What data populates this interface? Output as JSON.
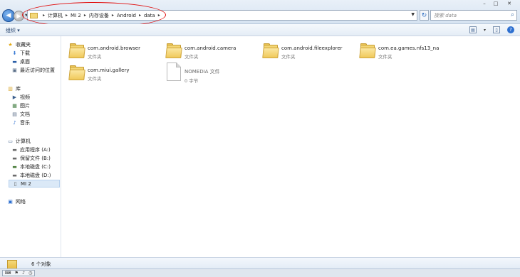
{
  "window_controls": {
    "minimize": "–",
    "maximize": "□",
    "close": "✕"
  },
  "address": {
    "crumbs": [
      "计算机",
      "MI 2",
      "内存设备",
      "Android",
      "data"
    ]
  },
  "search": {
    "placeholder": "搜索 data"
  },
  "toolbar": {
    "organize_label": "组织 ▾"
  },
  "sidebar": {
    "favorites": "收藏夹",
    "fav_items": [
      "下载",
      "桌面",
      "最近访问的位置"
    ],
    "libraries": "库",
    "lib_items": [
      "视频",
      "图片",
      "文档",
      "音乐"
    ],
    "computer": "计算机",
    "drives": [
      "应用程序 (A:)",
      "保留文件 (B:)",
      "本地磁盘 (C:)",
      "本地磁盘 (D:)",
      "MI 2"
    ],
    "network": "网络"
  },
  "files": [
    {
      "name": "com.android.browser",
      "sub": "文件夹",
      "type": "folder-icon"
    },
    {
      "name": "com.android.camera",
      "sub": "文件夹",
      "type": "folder-icon"
    },
    {
      "name": "com.android.fileexplorer",
      "sub": "文件夹",
      "type": "folder-icon"
    },
    {
      "name": "com.ea.games.nfs13_na",
      "sub": "文件夹",
      "type": "folder-icon"
    },
    {
      "name": "com.miui.gallery",
      "sub": "文件夹",
      "type": "folder-icon"
    },
    {
      "name": "NOMEDIA 文件",
      "sub": "0 字节",
      "type": "file-icon"
    }
  ],
  "details": {
    "count_label": "6 个对象"
  },
  "colors": {
    "annotation_oval": "#e01010",
    "selection": "#dbe9f7"
  }
}
